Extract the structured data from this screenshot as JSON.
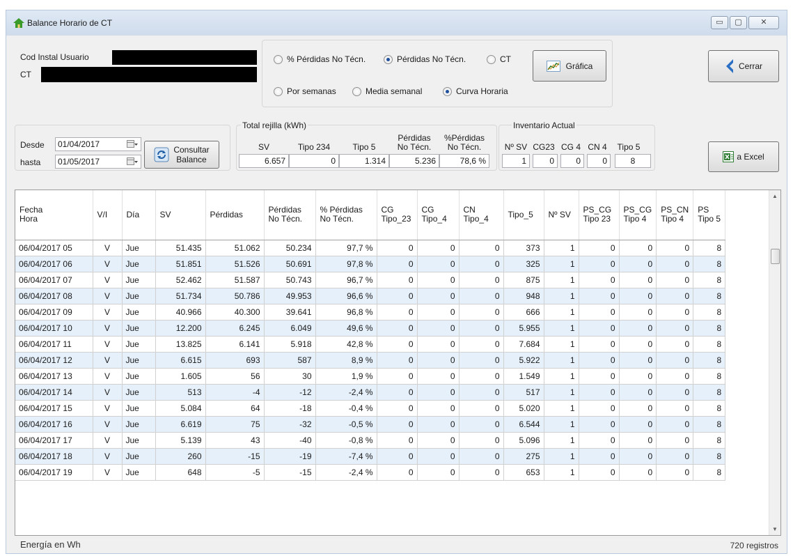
{
  "window": {
    "title": "Balance Horario de CT",
    "minimize_glyph": "▭",
    "maximize_glyph": "▢",
    "close_glyph": "✕"
  },
  "filters": {
    "cod_instal_label": "Cod Instal Usuario",
    "ct_label": "CT"
  },
  "mode_options": [
    {
      "label": "% Pérdidas No Técn.",
      "selected": false
    },
    {
      "label": "Pérdidas No Técn.",
      "selected": true
    },
    {
      "label": "CT",
      "selected": false
    }
  ],
  "period_options": [
    {
      "label": "Por semanas",
      "selected": false
    },
    {
      "label": "Media semanal",
      "selected": false
    },
    {
      "label": "Curva Horaria",
      "selected": true
    }
  ],
  "buttons": {
    "grafica": "Gráfica",
    "cerrar": "Cerrar",
    "consultar_line1": "Consultar",
    "consultar_line2": "Balance",
    "excel": "a Excel"
  },
  "dates": {
    "desde_label": "Desde",
    "desde_value": "01/04/2017",
    "hasta_label": "hasta",
    "hasta_value": "01/05/2017"
  },
  "total_rejilla": {
    "title": "Total rejilla (kWh)",
    "headers": [
      "SV",
      "Tipo 234",
      "Tipo 5",
      "Pérdidas\nNo Técn.",
      "%Pérdidas\nNo Técn."
    ],
    "values": [
      "6.657",
      "0",
      "1.314",
      "5.236",
      "78,6 %"
    ]
  },
  "inventario": {
    "title": "Inventario  Actual",
    "headers": [
      "Nº SV",
      "CG23",
      "CG 4",
      "CN 4",
      "Tipo 5"
    ],
    "values": [
      "1",
      "0",
      "0",
      "0",
      "8"
    ]
  },
  "grid": {
    "columns": [
      "Fecha\nHora",
      "V/I",
      "Día",
      "SV",
      "Pérdidas",
      "Pérdidas\nNo Técn.",
      "% Pérdidas\nNo Técn.",
      "CG\nTipo_23",
      "CG\nTipo_4",
      "CN\nTipo_4",
      "Tipo_5",
      "Nº SV",
      "PS_CG\nTipo 23",
      "PS_CG\nTipo 4",
      "PS_CN\nTipo 4",
      "PS\nTipo 5"
    ],
    "rows": [
      [
        "06/04/2017 05",
        "V",
        "Jue",
        "51.435",
        "51.062",
        "50.234",
        "97,7 %",
        "0",
        "0",
        "0",
        "373",
        "1",
        "0",
        "0",
        "0",
        "8"
      ],
      [
        "06/04/2017 06",
        "V",
        "Jue",
        "51.851",
        "51.526",
        "50.691",
        "97,8 %",
        "0",
        "0",
        "0",
        "325",
        "1",
        "0",
        "0",
        "0",
        "8"
      ],
      [
        "06/04/2017 07",
        "V",
        "Jue",
        "52.462",
        "51.587",
        "50.743",
        "96,7 %",
        "0",
        "0",
        "0",
        "875",
        "1",
        "0",
        "0",
        "0",
        "8"
      ],
      [
        "06/04/2017 08",
        "V",
        "Jue",
        "51.734",
        "50.786",
        "49.953",
        "96,6 %",
        "0",
        "0",
        "0",
        "948",
        "1",
        "0",
        "0",
        "0",
        "8"
      ],
      [
        "06/04/2017 09",
        "V",
        "Jue",
        "40.966",
        "40.300",
        "39.641",
        "96,8 %",
        "0",
        "0",
        "0",
        "666",
        "1",
        "0",
        "0",
        "0",
        "8"
      ],
      [
        "06/04/2017 10",
        "V",
        "Jue",
        "12.200",
        "6.245",
        "6.049",
        "49,6 %",
        "0",
        "0",
        "0",
        "5.955",
        "1",
        "0",
        "0",
        "0",
        "8"
      ],
      [
        "06/04/2017 11",
        "V",
        "Jue",
        "13.825",
        "6.141",
        "5.918",
        "42,8 %",
        "0",
        "0",
        "0",
        "7.684",
        "1",
        "0",
        "0",
        "0",
        "8"
      ],
      [
        "06/04/2017 12",
        "V",
        "Jue",
        "6.615",
        "693",
        "587",
        "8,9 %",
        "0",
        "0",
        "0",
        "5.922",
        "1",
        "0",
        "0",
        "0",
        "8"
      ],
      [
        "06/04/2017 13",
        "V",
        "Jue",
        "1.605",
        "56",
        "30",
        "1,9 %",
        "0",
        "0",
        "0",
        "1.549",
        "1",
        "0",
        "0",
        "0",
        "8"
      ],
      [
        "06/04/2017 14",
        "V",
        "Jue",
        "513",
        "-4",
        "-12",
        "-2,4 %",
        "0",
        "0",
        "0",
        "517",
        "1",
        "0",
        "0",
        "0",
        "8"
      ],
      [
        "06/04/2017 15",
        "V",
        "Jue",
        "5.084",
        "64",
        "-18",
        "-0,4 %",
        "0",
        "0",
        "0",
        "5.020",
        "1",
        "0",
        "0",
        "0",
        "8"
      ],
      [
        "06/04/2017 16",
        "V",
        "Jue",
        "6.619",
        "75",
        "-32",
        "-0,5 %",
        "0",
        "0",
        "0",
        "6.544",
        "1",
        "0",
        "0",
        "0",
        "8"
      ],
      [
        "06/04/2017 17",
        "V",
        "Jue",
        "5.139",
        "43",
        "-40",
        "-0,8 %",
        "0",
        "0",
        "0",
        "5.096",
        "1",
        "0",
        "0",
        "0",
        "8"
      ],
      [
        "06/04/2017 18",
        "V",
        "Jue",
        "260",
        "-15",
        "-19",
        "-7,4 %",
        "0",
        "0",
        "0",
        "275",
        "1",
        "0",
        "0",
        "0",
        "8"
      ],
      [
        "06/04/2017 19",
        "V",
        "Jue",
        "648",
        "-5",
        "-15",
        "-2,4 %",
        "0",
        "0",
        "0",
        "653",
        "1",
        "0",
        "0",
        "0",
        "8"
      ]
    ]
  },
  "status": {
    "left": "Energía en Wh",
    "right": "720 registros"
  },
  "colors": {
    "alt_row": "#e6f0fa",
    "accent": "#1f4f9a"
  }
}
